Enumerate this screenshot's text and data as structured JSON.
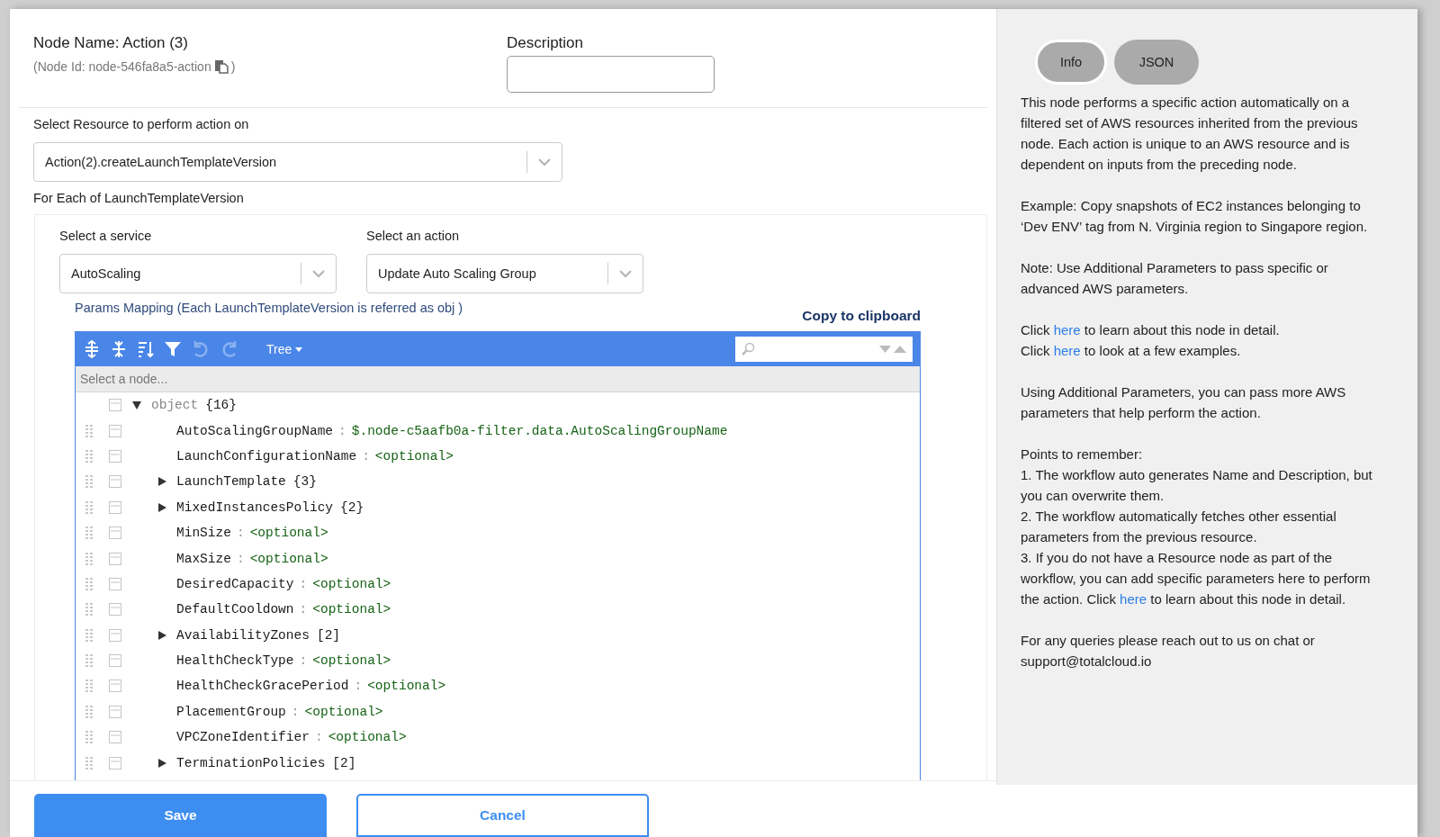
{
  "header": {
    "node_name": "Node Name: Action (3)",
    "node_id_prefix": "(Node Id: node-546fa8a5-action",
    "node_id_suffix": ")",
    "description_label": "Description"
  },
  "resource": {
    "label": "Select Resource to perform action on",
    "value": "Action(2).createLaunchTemplateVersion"
  },
  "for_each_label": "For Each of LaunchTemplateVersion",
  "service": {
    "label": "Select a service",
    "value": "AutoScaling"
  },
  "action": {
    "label": "Select an action",
    "value": "Update Auto Scaling Group"
  },
  "params_mapping": "Params Mapping (Each LaunchTemplateVersion is referred as obj )",
  "copy_button": "Copy to clipboard",
  "editor": {
    "mode": "Tree",
    "breadcrumb_placeholder": "Select a node...",
    "tree": {
      "key": "object",
      "count": "{16}",
      "expanded": true,
      "children": [
        {
          "key": "AutoScalingGroupName",
          "separator": ":",
          "value": "$.node-c5aafb0a-filter.data.AutoScalingGroupName"
        },
        {
          "key": "LaunchConfigurationName",
          "separator": ":",
          "value": "<optional>"
        },
        {
          "key": "LaunchTemplate",
          "count": "{3}",
          "expanded": false
        },
        {
          "key": "MixedInstancesPolicy",
          "count": "{2}",
          "expanded": false
        },
        {
          "key": "MinSize",
          "separator": ":",
          "value": "<optional>"
        },
        {
          "key": "MaxSize",
          "separator": ":",
          "value": "<optional>"
        },
        {
          "key": "DesiredCapacity",
          "separator": ":",
          "value": "<optional>"
        },
        {
          "key": "DefaultCooldown",
          "separator": ":",
          "value": "<optional>"
        },
        {
          "key": "AvailabilityZones",
          "count": "[2]",
          "expanded": false
        },
        {
          "key": "HealthCheckType",
          "separator": ":",
          "value": "<optional>"
        },
        {
          "key": "HealthCheckGracePeriod",
          "separator": ":",
          "value": "<optional>"
        },
        {
          "key": "PlacementGroup",
          "separator": ":",
          "value": "<optional>"
        },
        {
          "key": "VPCZoneIdentifier",
          "separator": ":",
          "value": "<optional>"
        },
        {
          "key": "TerminationPolicies",
          "count": "[2]",
          "expanded": false
        }
      ]
    }
  },
  "info_panel": {
    "tabs": [
      {
        "label": "Info",
        "selected": true
      },
      {
        "label": "JSON",
        "selected": false
      }
    ],
    "paragraphs": [
      [
        [
          {
            "kind": "text",
            "text": "This node performs a specific action automatically on a filtered set of AWS resources inherited from the previous node. Each action is unique to an AWS resource and is dependent on inputs from the preceding node."
          }
        ]
      ],
      [
        [
          {
            "kind": "text",
            "text": "Example: Copy snapshots of EC2 instances belonging to ‘Dev ENV’ tag from N. Virginia region to Singapore region."
          }
        ]
      ],
      [
        [
          {
            "kind": "text",
            "text": "Note: Use Additional Parameters to pass specific or advanced AWS parameters."
          }
        ]
      ],
      [
        [
          {
            "kind": "text",
            "text": "Click "
          },
          {
            "kind": "link",
            "text": "here"
          },
          {
            "kind": "text",
            "text": " to learn about this node in detail."
          }
        ],
        [
          {
            "kind": "text",
            "text": "Click "
          },
          {
            "kind": "link",
            "text": "here"
          },
          {
            "kind": "text",
            "text": " to look at a few examples."
          }
        ]
      ],
      [
        [
          {
            "kind": "text",
            "text": "Using Additional Parameters, you can pass more AWS parameters that help perform the action."
          }
        ]
      ],
      [
        [
          {
            "kind": "text",
            "text": "Points to remember:"
          }
        ],
        [
          {
            "kind": "text",
            "text": "1. The workflow auto generates Name and Description, but you can overwrite them."
          }
        ],
        [
          {
            "kind": "text",
            "text": "2. The workflow automatically fetches other essential parameters from the previous resource."
          }
        ],
        [
          {
            "kind": "text",
            "text": "3. If you do not have a Resource node as part of the workflow, you can add specific parameters here to perform the action. Click "
          },
          {
            "kind": "link",
            "text": "here"
          },
          {
            "kind": "text",
            "text": " to learn about this node in detail."
          }
        ]
      ],
      [
        [
          {
            "kind": "text",
            "text": "For any queries please reach out to us on chat or support@totalcloud.io"
          }
        ]
      ]
    ]
  },
  "footer": {
    "save": "Save",
    "cancel": "Cancel"
  }
}
